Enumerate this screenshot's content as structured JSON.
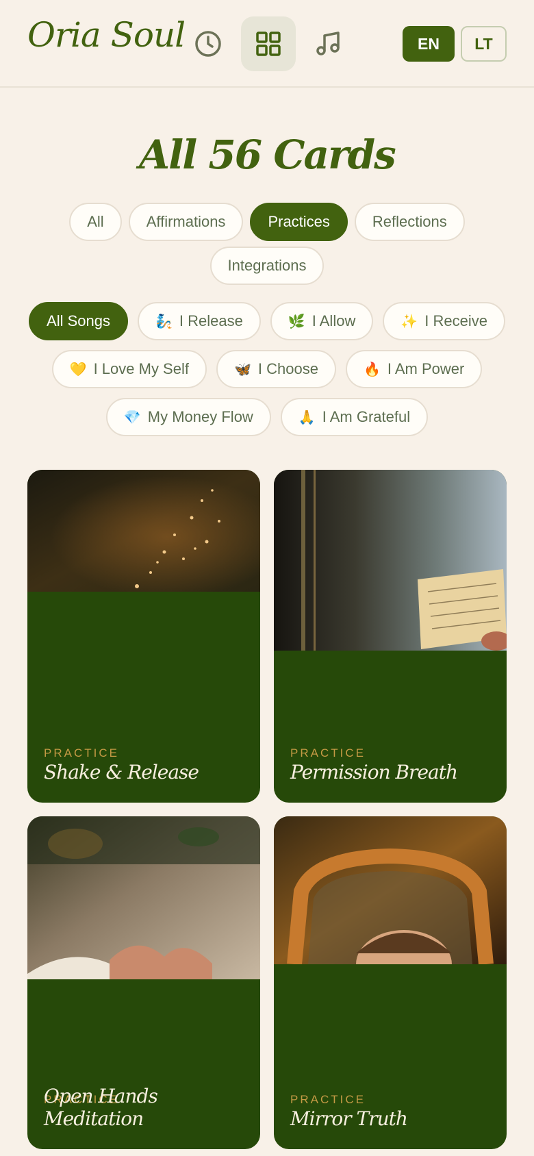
{
  "header": {
    "logo": "Oria Soul",
    "nav": [
      {
        "icon": "clock-icon"
      },
      {
        "icon": "grid-icon",
        "active": true
      },
      {
        "icon": "music-note-icon"
      }
    ],
    "languages": [
      "EN",
      "LT"
    ],
    "active_language": "EN"
  },
  "title": "All 56 Cards",
  "type_filters": {
    "items": [
      "All",
      "Affirmations",
      "Practices",
      "Reflections",
      "Integrations"
    ],
    "active": "Practices"
  },
  "song_filters": {
    "active": "All Songs",
    "items": [
      {
        "emoji": "",
        "label": "All Songs"
      },
      {
        "emoji": "🧞",
        "label": "I Release"
      },
      {
        "emoji": "🌿",
        "label": "I Allow"
      },
      {
        "emoji": "✨",
        "label": "I Receive"
      },
      {
        "emoji": "💛",
        "label": "I Love My Self"
      },
      {
        "emoji": "🦋",
        "label": "I Choose"
      },
      {
        "emoji": "🔥",
        "label": "I Am Power"
      },
      {
        "emoji": "💎",
        "label": "My Money Flow"
      },
      {
        "emoji": "🙏",
        "label": "I Am Grateful"
      }
    ]
  },
  "cards": [
    {
      "category": "PRACTICE",
      "title": "Shake & Release",
      "image": "dandelion-seeds-image"
    },
    {
      "category": "PRACTICE",
      "title": "Permission Breath",
      "image": "handwritten-letter-image"
    },
    {
      "category": "PRACTICE",
      "title": "Open Hands Meditation",
      "image": "open-hands-image"
    },
    {
      "category": "PRACTICE",
      "title": "Mirror Truth",
      "image": "mirror-image"
    }
  ],
  "colors": {
    "background": "#f8f1e8",
    "accent": "#42620f",
    "card": "#264909",
    "card_label": "#c59a45"
  }
}
